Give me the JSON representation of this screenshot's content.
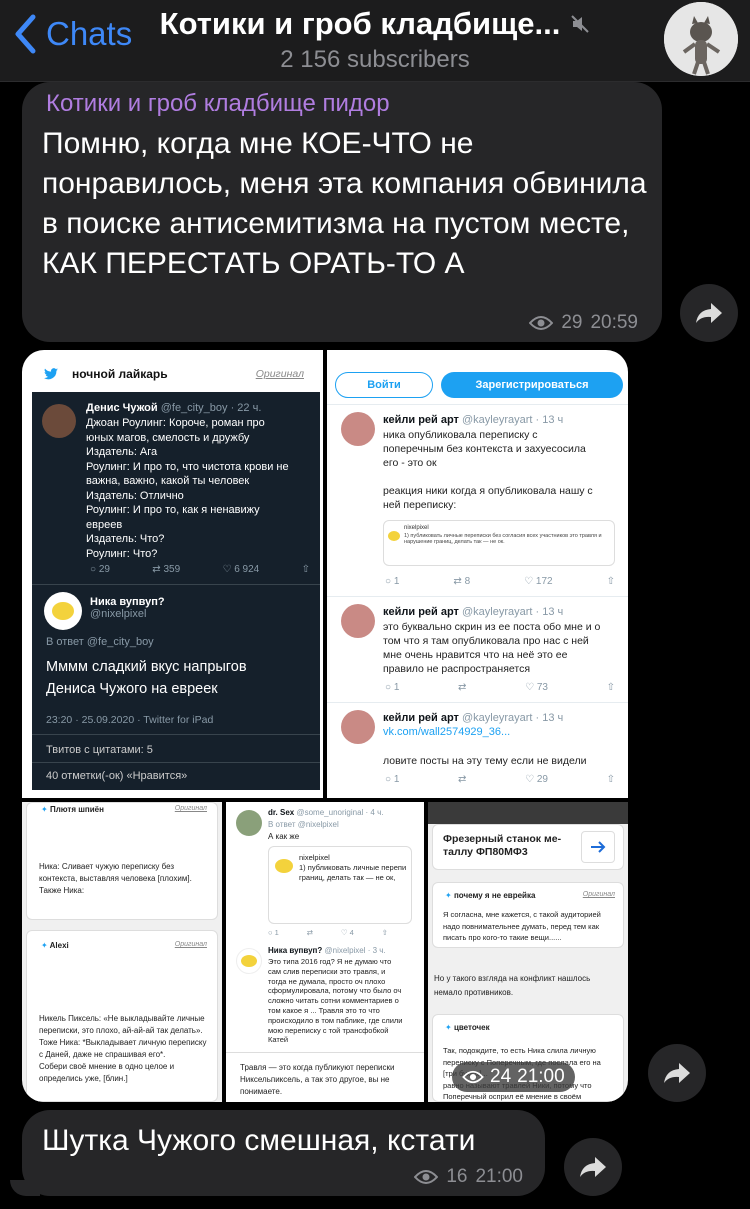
{
  "header": {
    "back_label": "Chats",
    "title": "Котики и гроб кладбище...",
    "subtitle": "2 156 subscribers"
  },
  "messages": [
    {
      "sender": "Котики и гроб кладбище пидор",
      "text": "Помню, когда мне КОЕ-ЧТО не понравилось, меня эта компания обвинила в поиске антисемитизма на пустом месте, КАК ПЕРЕСТАТЬ ОРАТЬ-ТО А",
      "views": "29",
      "time": "20:59"
    },
    {
      "views": "24",
      "time": "21:00"
    },
    {
      "text": "Шутка Чужого смешная, кстати",
      "views": "16",
      "time": "21:00"
    }
  ],
  "album": {
    "p1": {
      "source": "ночной лайкарь",
      "orig": "Оригинал",
      "author": "Денис Чужой",
      "handle": "@fe_city_boy · 22 ч.",
      "lines": [
        "Джоан Роулинг: Короче, роман про",
        "юных магов, смелость и дружбу",
        "Издатель: Ага",
        "Роулинг: И про то, что чистота крови не",
        "важна, важно, какой ты человек",
        "Издатель: Отлично",
        "Роулинг: И про то, как я ненавижу",
        "евреев",
        "Издатель: Что?",
        "Роулинг: Что?"
      ],
      "stats": [
        "29",
        "359",
        "6 924"
      ],
      "reply_author": "Ника вупвуп?",
      "reply_handle": "@nixelpixel",
      "in_reply": "В ответ @fe_city_boy",
      "reply_text": [
        "Мммм сладкий вкус напрыгов",
        "Дениса Чужого на евреек"
      ],
      "date": "23:20 · 25.09.2020 · Twitter for iPad",
      "quotes_label": "Твитов с цитатами: 5",
      "likes_label": "40 отметки(-ок) «Нравится»"
    },
    "p2": {
      "login": "Войти",
      "signup": "Зарегистрироваться",
      "t1": {
        "author": "кейли рей арт",
        "handle": "@kayleyrayart · 13 ч",
        "text": [
          "ника опубликовала переписку с",
          "поперечным без контекста и захуесосила",
          "его - это ок",
          "",
          "реакция ники когда я опубликовала нашу с",
          "ней переписку:"
        ],
        "quote_name": "nixelpixel",
        "quote_text": "1) публиковать личные переписки без согласия всех участников это травля и нарушение границ, делать так — не ок.",
        "stats": [
          "1",
          "8",
          "172"
        ]
      },
      "t2": {
        "author": "кейли рей арт",
        "handle": "@kayleyrayart · 13 ч",
        "text": [
          "это буквально скрин из ее поста обо мне и о",
          "том что я там опубликовала про нас с ней",
          "мне очень нравится что на неё это ее",
          "правило не распространяется"
        ],
        "stats": [
          "1",
          "",
          "73"
        ]
      },
      "t3": {
        "author": "кейли рей арт",
        "handle": "@kayleyrayart · 13 ч",
        "link": "vk.com/wall2574929_36...",
        "text": "ловите посты на эту тему если не видели",
        "stats": [
          "1",
          "",
          "29"
        ]
      }
    },
    "p3": {
      "c1_name": "Плютя шпиён",
      "orig": "Оригинал",
      "c1_text": [
        "Ника: Сливает чужую переписку без",
        "контекста, выставляя человека [плохим].",
        "Также Ника:"
      ],
      "c2_name": "Alexi",
      "c2_text": [
        "Никель Пиксель: «Не выкладывайте личные",
        "переписки, это плохо, ай-ай-ай так делать».",
        "Тоже Ника: *Выкладывает личную переписку",
        "с Даней, даже не спрашивая его*.",
        "Собери своё мнение в одно целое и",
        "определись уже, [блин.]"
      ]
    },
    "p4": {
      "author": "dr. Sex",
      "handle": "@some_unoriginal · 4 ч.",
      "in_reply": "В ответ @nixelpixel",
      "text": "А как же",
      "quote_name": "nixelpixel",
      "quote_text": [
        "1) публиковать личные перепи",
        "границ, делать так — не ок,"
      ],
      "stats": [
        "1",
        "",
        "4"
      ],
      "r_author": "Ника вупвуп?",
      "r_handle": "@nixelpixel · 3 ч.",
      "r_text": [
        "Это типа 2016 год? Я не думаю что",
        "сам слив переписки это травля, и",
        "тогда не думала, просто оч плохо",
        "сформулировала, потому что было оч",
        "сложно читать сотни комментариев о",
        "том какое я ... Травля это то что",
        "происходило в том паблике, где слили",
        "мою переписку с той трансфобкой",
        "Катей"
      ],
      "bottom": [
        "Травля — это когда публикуют переписки",
        "Никсельпиксель, а так это другое, вы не",
        "понимаете."
      ]
    },
    "p5": {
      "ad": [
        "Фрезерный станок ме-",
        "таллу ФП80МФ3"
      ],
      "c1_name": "почему я не еврейка",
      "orig": "Оригинал",
      "c1_text": [
        "Я согласна, мне кажется, с такой аудиторией",
        "надо повнимательнее думать, перед тем как",
        "писать про кого-то такие вещи......"
      ],
      "mid": [
        "Но у такого взгляда на конфликт нашлось",
        "немало противников."
      ],
      "c2_name": "цветочек",
      "c2_text": [
        "Так, подождите, то есть Ника слила личную",
        "переписку с Поперечным, где послала его на",
        "[три буквы]...",
        "равно называют травлей Ники, потому что",
        "Поперечный осприл её мнение в своём"
      ]
    }
  },
  "colors": {
    "accent": "#3e88f7",
    "bubble": "#262628",
    "sender": "#b07de0",
    "meta": "#8d8e93"
  }
}
